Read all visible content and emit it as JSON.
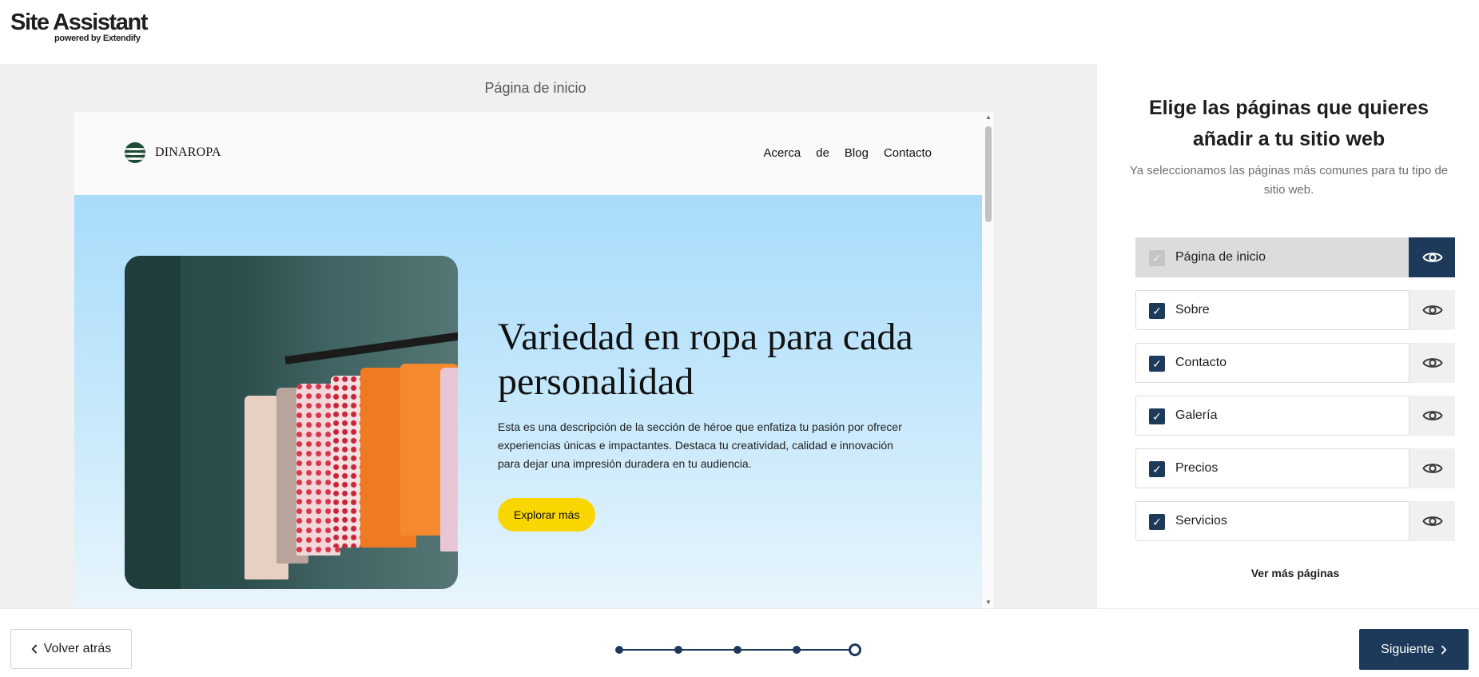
{
  "app": {
    "title": "Site Assistant",
    "subtitle": "powered by Extendify"
  },
  "preview": {
    "title": "Página de inicio",
    "site": {
      "brand": "DINAROPA",
      "nav": [
        "Acerca",
        "de",
        "Blog",
        "Contacto"
      ],
      "hero": {
        "heading": "Variedad en ropa para cada personalidad",
        "description": "Esta es una descripción de la sección de héroe que enfatiza tu pasión por ofrecer experiencias únicas e impactantes. Destaca tu creatividad, calidad e innovación para dejar una impresión duradera en tu audiencia.",
        "button": "Explorar más"
      }
    }
  },
  "panel": {
    "heading": "Elige las páginas que quieres añadir a tu sitio web",
    "subheading": "Ya seleccionamos las páginas más comunes para tu tipo de sitio web.",
    "pages": [
      {
        "label": "Página de inicio",
        "checked": true,
        "locked": true
      },
      {
        "label": "Sobre",
        "checked": true,
        "locked": false
      },
      {
        "label": "Contacto",
        "checked": true,
        "locked": false
      },
      {
        "label": "Galería",
        "checked": true,
        "locked": false
      },
      {
        "label": "Precios",
        "checked": true,
        "locked": false
      },
      {
        "label": "Servicios",
        "checked": true,
        "locked": false
      }
    ],
    "more_link": "Ver más páginas"
  },
  "footer": {
    "back_label": "Volver atrás",
    "next_label": "Siguiente",
    "steps_total": 5,
    "current_step": 5
  },
  "colors": {
    "primary": "#1e3a5a",
    "accent": "#f9d600",
    "hero_top": "#a7dcfb",
    "locked_bg": "#dcdcdc"
  },
  "icons": {
    "preview": "eye-icon",
    "check": "checkmark-icon",
    "back": "chevron-left-icon",
    "next": "chevron-right-icon"
  }
}
